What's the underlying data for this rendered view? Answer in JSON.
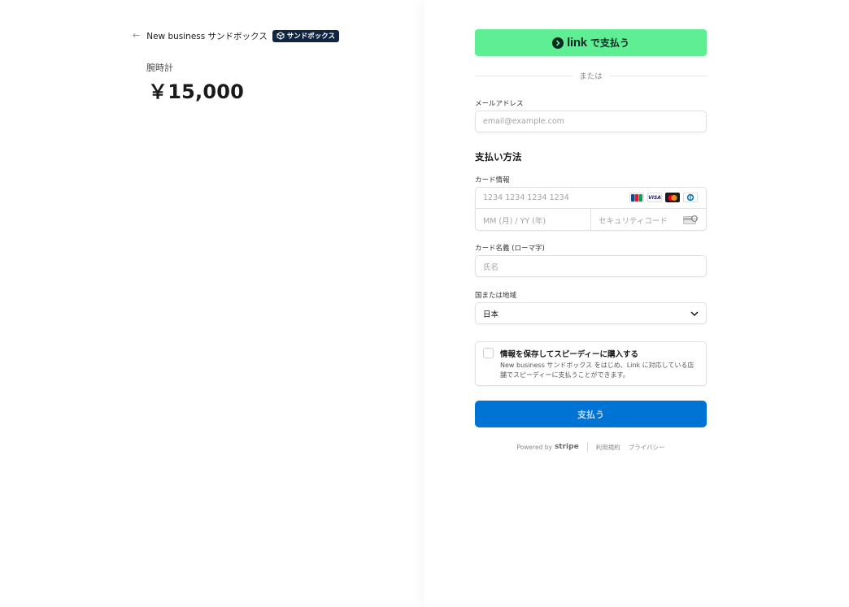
{
  "summary": {
    "back_arrow": "←",
    "merchant_name": "New business サンドボックス",
    "sandbox_badge": "サンドボックス",
    "product_name": "腕時計",
    "price": "￥15,000"
  },
  "checkout": {
    "link_button": {
      "word": "link",
      "pay": "で支払う"
    },
    "or_text": "または",
    "email": {
      "label": "メールアドレス",
      "placeholder": "email@example.com"
    },
    "payment_method_title": "支払い方法",
    "card": {
      "label": "カード情報",
      "number_placeholder": "1234 1234 1234 1234",
      "expiry_placeholder": "MM (月) / YY (年)",
      "cvc_placeholder": "セキュリティコード",
      "brands": [
        "jcb-icon",
        "visa-icon",
        "mastercard-icon",
        "diners-icon"
      ],
      "visa_text": "VISA"
    },
    "cardholder": {
      "label": "カード名義 (ローマ字)",
      "placeholder": "氏名"
    },
    "country": {
      "label": "国または地域",
      "value": "日本"
    },
    "save_info": {
      "title": "情報を保存してスピーディーに購入する",
      "description": "New business サンドボックス をはじめ、Link に対応している店舗でスピーディーに支払うことができます。"
    },
    "pay_button": "支払う",
    "footer": {
      "powered_by": "Powered by",
      "stripe": "stripe",
      "terms": "利用規約",
      "privacy": "プライバシー"
    }
  },
  "colors": {
    "link_green": "#5fee93",
    "pay_blue": "#0074d4",
    "badge_navy": "#0f2542"
  }
}
